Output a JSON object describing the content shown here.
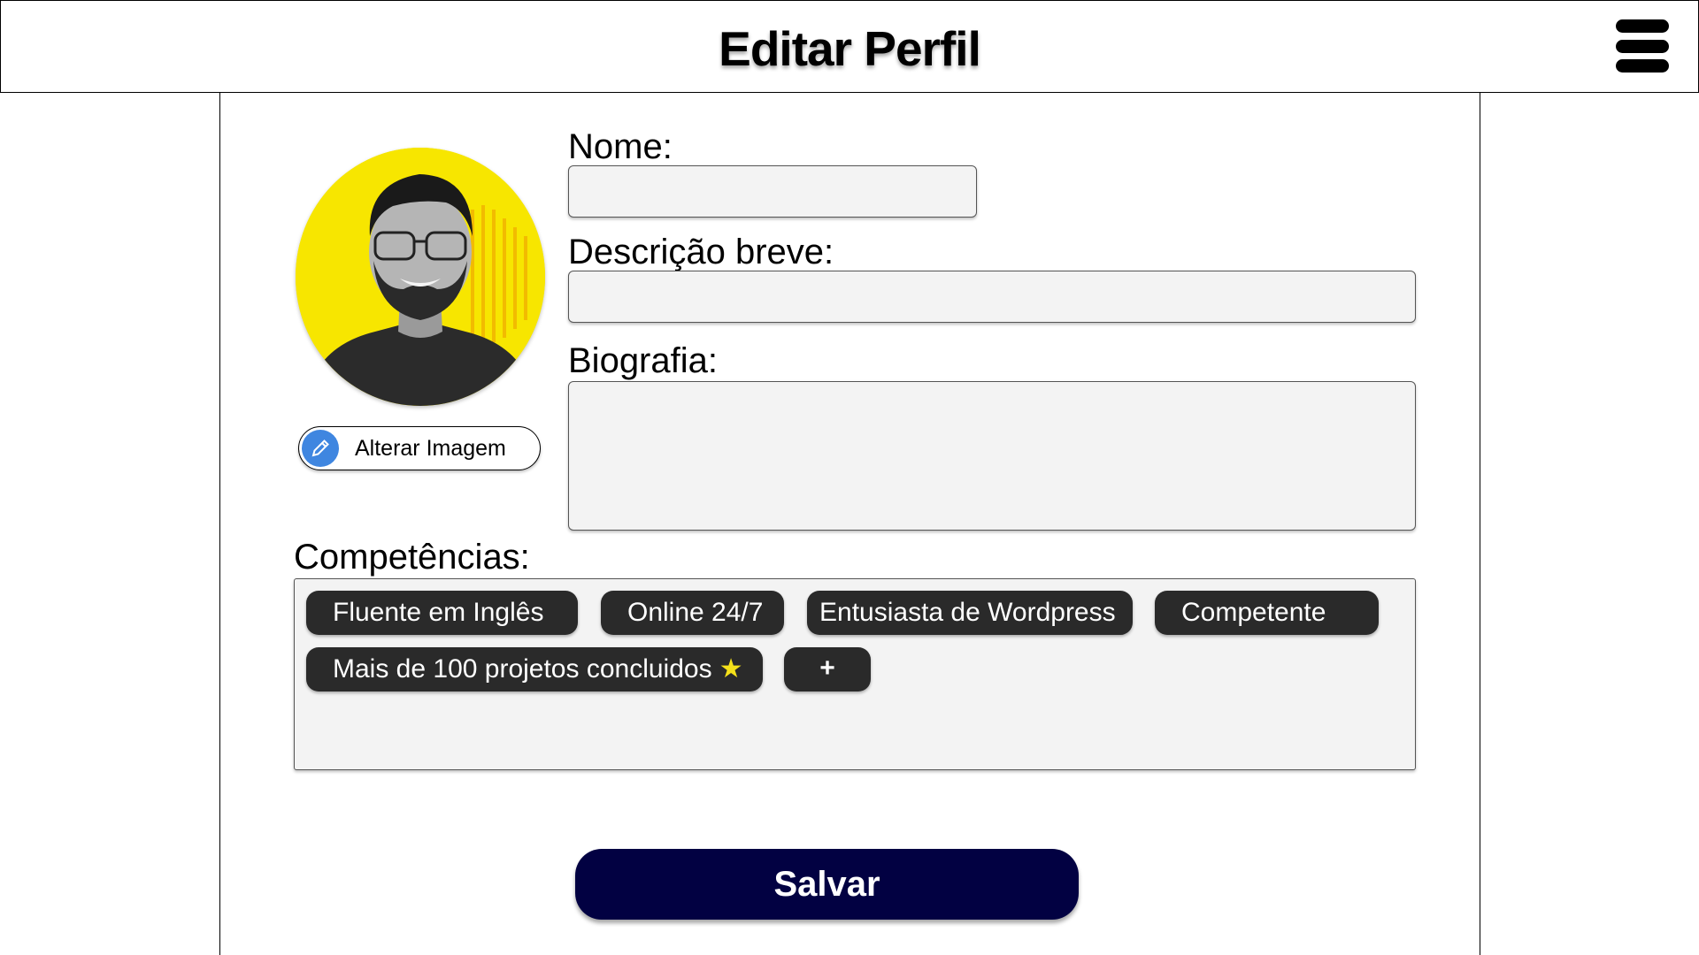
{
  "header": {
    "title": "Editar Perfil",
    "menu_icon": "hamburger-menu-icon"
  },
  "profile": {
    "avatar_alt": "profile-photo",
    "change_image_label": "Alterar Imagem",
    "change_image_icon": "pencil-icon"
  },
  "form": {
    "name_label": "Nome:",
    "name_value": "",
    "short_desc_label": "Descrição breve:",
    "short_desc_value": "",
    "bio_label": "Biografia:",
    "bio_value": ""
  },
  "skills": {
    "label": "Competências:",
    "chips": [
      "Fluente em Inglês",
      "Online 24/7",
      "Entusiasta de Wordpress",
      "Competente",
      "Mais de 100 projetos concluidos"
    ],
    "star": "★",
    "add_label": "+"
  },
  "actions": {
    "save_label": "Salvar"
  },
  "colors": {
    "save_bg": "#020142",
    "chip_bg": "#2a2a2a",
    "avatar_bg": "#f7e600",
    "pencil_bg": "#3f86e0",
    "star": "#f5e11a"
  }
}
